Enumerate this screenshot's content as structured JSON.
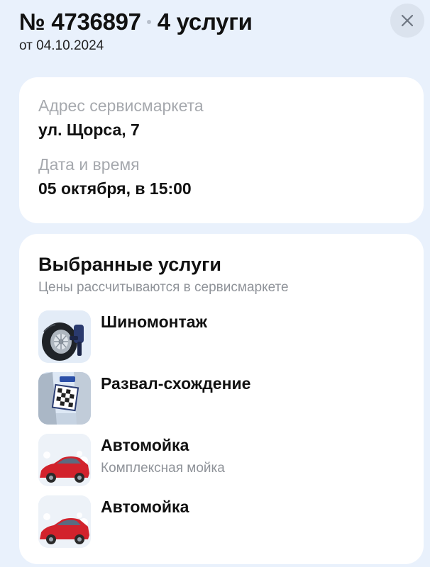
{
  "order": {
    "number": "№ 4736897",
    "services_count": "4 услуги",
    "date": "от 04.10.2024"
  },
  "close_icon": "close-icon",
  "info": {
    "address_label": "Адрес сервисмаркета",
    "address_value": "ул. Щорса, 7",
    "datetime_label": "Дата и время",
    "datetime_value": "05 октября, в 15:00"
  },
  "services": {
    "title": "Выбранные услуги",
    "subtitle": "Цены рассчитываются в сервисмаркете",
    "items": [
      {
        "name": "Шиномонтаж",
        "subtitle": "",
        "image": "tire-fitting-image"
      },
      {
        "name": "Развал-схождение",
        "subtitle": "",
        "image": "wheel-alignment-image"
      },
      {
        "name": "Автомойка",
        "subtitle": "Комплексная мойка",
        "image": "car-wash-image"
      },
      {
        "name": "Автомойка",
        "subtitle": "",
        "image": "car-wash-image"
      }
    ]
  },
  "colors": {
    "background": "#e9f1fc",
    "card": "#ffffff",
    "muted_text": "#a6a9ae",
    "close_button": "#dbe3ee",
    "car_red": "#d2222c"
  }
}
